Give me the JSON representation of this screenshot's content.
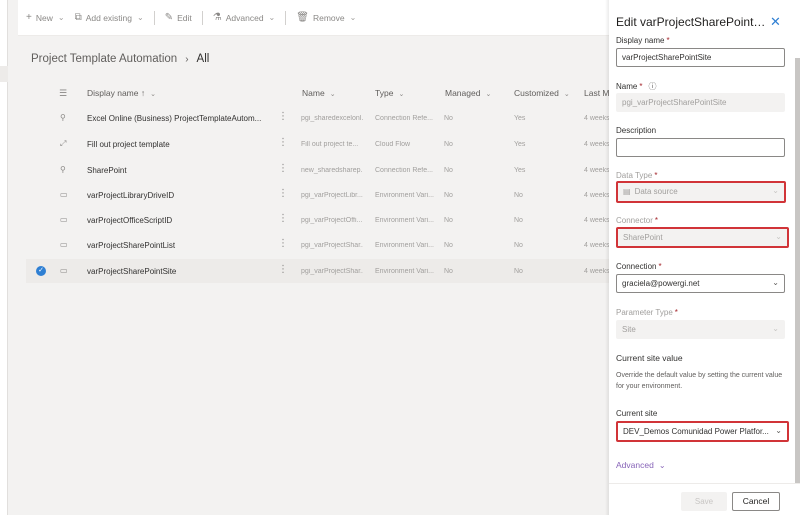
{
  "commandbar": {
    "new": "New",
    "add_existing": "Add existing",
    "edit": "Edit",
    "advanced": "Advanced",
    "remove": "Remove"
  },
  "breadcrumb": {
    "parent": "Project Template Automation",
    "current": "All"
  },
  "grid": {
    "columns": {
      "display_name": "Display name",
      "display_name_sort": "↑",
      "name": "Name",
      "type": "Type",
      "managed": "Managed",
      "customized": "Customized",
      "last_modified": "Last M"
    },
    "rows": [
      {
        "display_name": "Excel Online (Business) ProjectTemplateAutom...",
        "name": "pgi_sharedexcelonl...",
        "type": "Connection Refe...",
        "managed": "No",
        "customized": "Yes",
        "last": "4 weeks",
        "icon": "connection-reference-icon",
        "selected": false
      },
      {
        "display_name": "Fill out project template",
        "name": "Fill out project te...",
        "type": "Cloud Flow",
        "managed": "No",
        "customized": "Yes",
        "last": "4 weeks",
        "icon": "flow-icon",
        "selected": false
      },
      {
        "display_name": "SharePoint",
        "name": "new_sharedsharep...",
        "type": "Connection Refe...",
        "managed": "No",
        "customized": "Yes",
        "last": "4 weeks",
        "icon": "connection-reference-icon",
        "selected": false
      },
      {
        "display_name": "varProjectLibraryDriveID",
        "name": "pgi_varProjectLibr...",
        "type": "Environment Vari...",
        "managed": "No",
        "customized": "No",
        "last": "4 weeks",
        "icon": "environment-variable-icon",
        "selected": false
      },
      {
        "display_name": "varProjectOfficeScriptID",
        "name": "pgi_varProjectOffi...",
        "type": "Environment Vari...",
        "managed": "No",
        "customized": "No",
        "last": "4 weeks",
        "icon": "environment-variable-icon",
        "selected": false
      },
      {
        "display_name": "varProjectSharePointList",
        "name": "pgi_varProjectShar...",
        "type": "Environment Vari...",
        "managed": "No",
        "customized": "No",
        "last": "4 weeks",
        "icon": "environment-variable-icon",
        "selected": false
      },
      {
        "display_name": "varProjectSharePointSite",
        "name": "pgi_varProjectShar...",
        "type": "Environment Vari...",
        "managed": "No",
        "customized": "No",
        "last": "4 weeks",
        "icon": "environment-variable-icon",
        "selected": true
      }
    ]
  },
  "panel": {
    "title": "Edit varProjectSharePointSite",
    "display_name_label": "Display name",
    "display_name_value": "varProjectSharePointSite",
    "name_label": "Name",
    "name_value": "pgi_varProjectSharePointSite",
    "description_label": "Description",
    "description_value": "",
    "data_type_label": "Data Type",
    "data_type_value": "Data source",
    "connector_label": "Connector",
    "connector_value": "SharePoint",
    "connection_label": "Connection",
    "connection_value": "graciela@powergi.net",
    "parameter_type_label": "Parameter Type",
    "parameter_type_value": "Site",
    "current_site_value_heading": "Current site value",
    "current_site_value_desc": "Override the default value by setting the current value for your environment.",
    "current_site_label": "Current site",
    "current_site_value": "DEV_Demos Comunidad Power Platfor...",
    "advanced": "Advanced",
    "save": "Save",
    "cancel": "Cancel",
    "required_mark": "*"
  },
  "colors": {
    "accent": "#2f7fd3",
    "highlight_border": "#d13438",
    "advanced_link": "#8764b8"
  }
}
